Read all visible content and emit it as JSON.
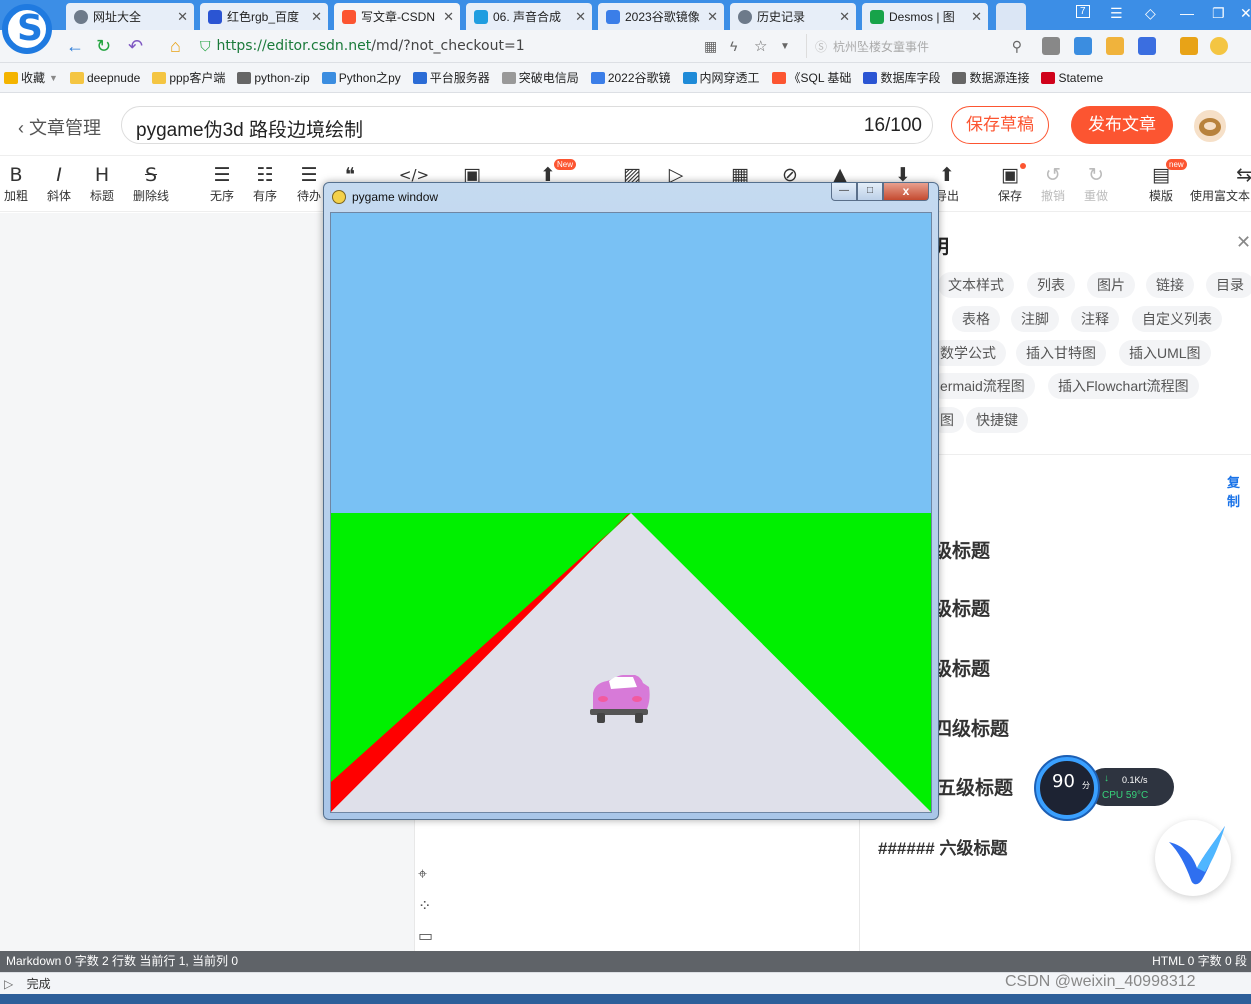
{
  "browser": {
    "tabs": [
      {
        "label": "网址大全",
        "icon_color": "#6d7a8a"
      },
      {
        "label": "红色rgb_百度",
        "icon_color": "#2b55d3"
      },
      {
        "label": "写文章-CSDN",
        "icon_color": "#fc5531"
      },
      {
        "label": "06. 声音合成",
        "icon_color": "#1f9de0"
      },
      {
        "label": "2023谷歌镜像",
        "icon_color": "#3b7ee8"
      },
      {
        "label": "历史记录",
        "icon_color": "#6d7a8a"
      },
      {
        "label": "Desmos | 图",
        "icon_color": "#17a34a"
      }
    ],
    "url_host": "https://editor.csdn.net",
    "url_path": "/md/?not_checkout=1",
    "search_placeholder": "杭州坠楼女童事件",
    "bookmarks": [
      {
        "label": "收藏",
        "icon_color": "#f4b400"
      },
      {
        "label": "deepnude",
        "icon_color": "#f4c542"
      },
      {
        "label": "ppp客户端",
        "icon_color": "#f4c542"
      },
      {
        "label": "python-zip",
        "icon_color": "#666666"
      },
      {
        "label": "Python之py",
        "icon_color": "#3b8de0"
      },
      {
        "label": "平台服务器",
        "icon_color": "#2b6cd6"
      },
      {
        "label": "突破电信局",
        "icon_color": "#999999"
      },
      {
        "label": "2022谷歌镜",
        "icon_color": "#3b7ee8"
      },
      {
        "label": "内网穿透工",
        "icon_color": "#1f8bd8"
      },
      {
        "label": "《SQL 基础",
        "icon_color": "#fc5531"
      },
      {
        "label": "数据库字段",
        "icon_color": "#2b55d3"
      },
      {
        "label": "数据源连接",
        "icon_color": "#666666"
      },
      {
        "label": "Stateme",
        "icon_color": "#d0021b"
      }
    ],
    "status": "完成"
  },
  "editor": {
    "back_label": "文章管理",
    "title": "pygame伪3d 路段边境绘制",
    "title_count": "16/100",
    "save_draft": "保存草稿",
    "publish": "发布文章",
    "toolbar": [
      {
        "label": "加粗",
        "glyph": "B"
      },
      {
        "label": "斜体",
        "glyph": "I"
      },
      {
        "label": "标题",
        "glyph": "H"
      },
      {
        "label": "删除线",
        "glyph": "S"
      },
      {
        "label": "无序",
        "glyph": "☰"
      },
      {
        "label": "有序",
        "glyph": "☷"
      },
      {
        "label": "待办",
        "glyph": "☰"
      },
      {
        "label": "",
        "glyph": "❝"
      },
      {
        "label": "",
        "glyph": "</>"
      },
      {
        "label": "",
        "glyph": "▣"
      },
      {
        "label": "",
        "glyph": "⬆",
        "badge": "New"
      },
      {
        "label": "",
        "glyph": "▨"
      },
      {
        "label": "",
        "glyph": "▷"
      },
      {
        "label": "",
        "glyph": "▦"
      },
      {
        "label": "",
        "glyph": "⊘"
      },
      {
        "label": "",
        "glyph": "▲"
      },
      {
        "label": "",
        "glyph": "⬇"
      },
      {
        "label": "导出",
        "glyph": "⬆"
      },
      {
        "label": "保存",
        "glyph": "▣"
      },
      {
        "label": "撤销",
        "glyph": "↺"
      },
      {
        "label": "重做",
        "glyph": "↻"
      },
      {
        "label": "模版",
        "glyph": "▤",
        "badge": "new"
      },
      {
        "label": "使用富文本",
        "glyph": "⇆"
      }
    ],
    "help": {
      "title": "明",
      "chips": [
        "文本样式",
        "列表",
        "图片",
        "链接",
        "目录",
        "表格",
        "注脚",
        "注释",
        "自定义列表",
        "数学公式",
        "插入甘特图",
        "插入UML图",
        "ermaid流程图",
        "插入Flowchart流程图",
        "图",
        "快捷键"
      ],
      "copy": "复制",
      "headings": [
        "级标题",
        "级标题",
        "级标题",
        "四级标题",
        "五级标题",
        "###### 六级标题"
      ]
    },
    "statusbar_left": "Markdown  0 字数  2 行数  当前行 1, 当前列 0",
    "statusbar_right": "HTML  0 字数  0 段"
  },
  "pygame_window": {
    "title": "pygame window",
    "min_label": "—",
    "max_label": "□",
    "close_label": "x",
    "scene": {
      "sky_color": "#79c1f4",
      "grass_color": "#00f000",
      "road_color": "#dfe0ea",
      "border_color": "#ff0000",
      "car_color": "#d77ad8"
    }
  },
  "widget": {
    "score": "90",
    "score_unit": "分",
    "net_speed": "0.1K/s",
    "cpu": "CPU 59°C"
  },
  "watermark": "CSDN @weixin_40998312"
}
